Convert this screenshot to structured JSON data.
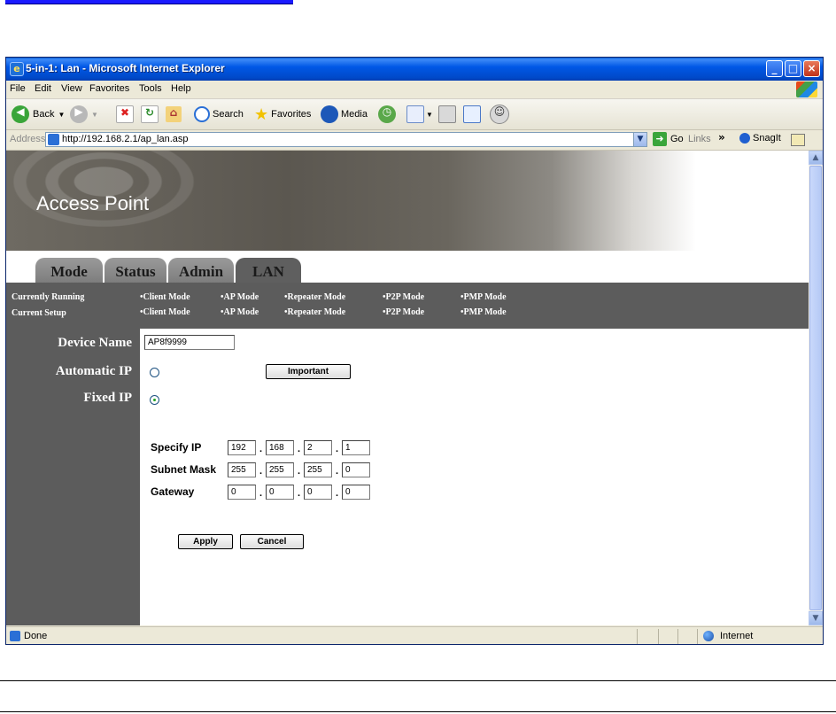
{
  "window": {
    "title": "5-in-1: Lan - Microsoft Internet Explorer",
    "min": "_",
    "max": "□",
    "close": "×"
  },
  "menu": {
    "file": "File",
    "edit": "Edit",
    "view": "View",
    "favorites": "Favorites",
    "tools": "Tools",
    "help": "Help"
  },
  "toolbar": {
    "back": "Back",
    "search": "Search",
    "favorites": "Favorites",
    "media": "Media"
  },
  "address": {
    "label": "Address",
    "url": "http://192.168.2.1/ap_lan.asp",
    "go": "Go",
    "links": "Links",
    "snagit": "SnagIt"
  },
  "banner": {
    "title": "Access Point"
  },
  "tabs": [
    {
      "label": "Mode",
      "active": false
    },
    {
      "label": "Status",
      "active": false
    },
    {
      "label": "Admin",
      "active": false
    },
    {
      "label": "LAN",
      "active": true
    }
  ],
  "status_band": {
    "running_label": "Currently Running",
    "setup_label": "Current Setup",
    "running_modes": [
      "•Client Mode",
      "•AP Mode",
      "•Repeater Mode",
      "•P2P Mode",
      "•PMP Mode"
    ],
    "setup_modes": [
      "•Client Mode",
      "•AP Mode",
      "•Repeater Mode",
      "•P2P Mode",
      "•PMP Mode"
    ]
  },
  "form": {
    "device_name_label": "Device Name",
    "device_name_value": "AP8f9999",
    "automatic_ip_label": "Automatic IP",
    "fixed_ip_label": "Fixed IP",
    "ip_mode": "fixed",
    "important_button": "Important",
    "specify_ip_label": "Specify IP",
    "specify_ip": [
      "192",
      "168",
      "2",
      "1"
    ],
    "subnet_mask_label": "Subnet Mask",
    "subnet_mask": [
      "255",
      "255",
      "255",
      "0"
    ],
    "gateway_label": "Gateway",
    "gateway": [
      "0",
      "0",
      "0",
      "0"
    ],
    "apply_button": "Apply",
    "cancel_button": "Cancel"
  },
  "statusbar": {
    "status": "Done",
    "zone": "Internet"
  }
}
